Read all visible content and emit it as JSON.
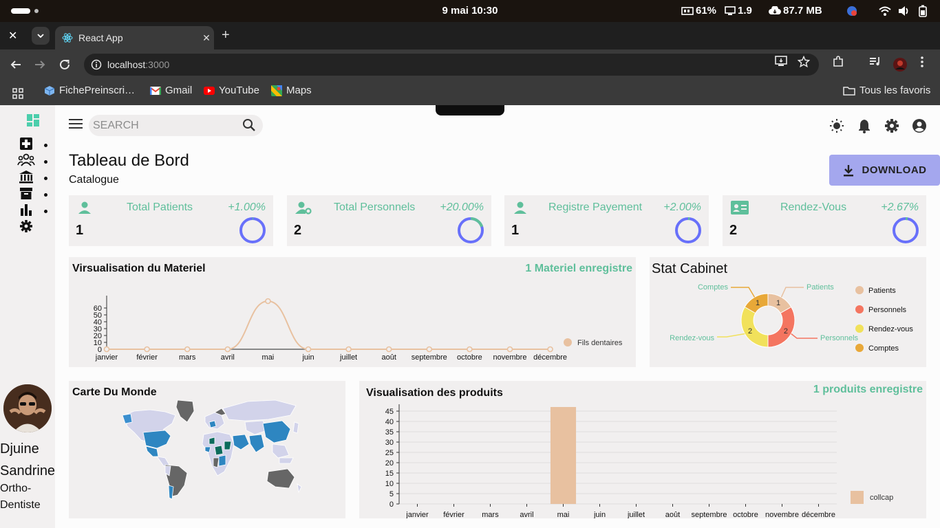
{
  "status_bar": {
    "date_time": "9 mai  10:30",
    "battery_saver": "61%",
    "screen_value": "1.9",
    "data_usage": "87.7 MB"
  },
  "browser": {
    "tab_title": "React App",
    "url_host": "localhost",
    "url_port": ":3000",
    "bookmarks": [
      "FichePreinscri…",
      "Gmail",
      "YouTube",
      "Maps"
    ],
    "all_bookmarks": "Tous les favoris"
  },
  "topbar": {
    "search_placeholder": "SEARCH"
  },
  "header": {
    "title": "Tableau de Bord",
    "subtitle": "Catalogue",
    "download_label": "DOWNLOAD"
  },
  "stats": [
    {
      "title": "Total Patients",
      "value": "1",
      "change": "+1.00%",
      "progress": 0.01
    },
    {
      "title": "Total Personnels",
      "value": "2",
      "change": "+20.00%",
      "progress": 0.2
    },
    {
      "title": "Registre Payement",
      "value": "1",
      "change": "+2.00%",
      "progress": 0.02
    },
    {
      "title": "Rendez-Vous",
      "value": "2",
      "change": "+2.67%",
      "progress": 0.0267
    }
  ],
  "materiel": {
    "title": "Virsualisation du Materiel",
    "count_label": "1 Materiel enregistre"
  },
  "cabinet": {
    "title": "Stat Cabinet"
  },
  "map": {
    "title": "Carte Du Monde"
  },
  "produits": {
    "title": "Visualisation des produits",
    "count_label": "1 produits enregistre"
  },
  "user": {
    "first_name": "Djuine",
    "last_name": "Sandrine",
    "role_line1": "Ortho-",
    "role_line2": "Dentiste"
  },
  "chart_data": [
    {
      "type": "line",
      "categories": [
        "janvier",
        "février",
        "mars",
        "avril",
        "mai",
        "juin",
        "juillet",
        "août",
        "septembre",
        "octobre",
        "novembre",
        "décembre"
      ],
      "series": [
        {
          "name": "Fils dentaires",
          "values": [
            0,
            0,
            0,
            0,
            70,
            0,
            0,
            0,
            0,
            0,
            0,
            0
          ],
          "color": "#e8c1a0"
        }
      ],
      "yticks": [
        0,
        10,
        20,
        30,
        40,
        50,
        60
      ],
      "ylim": [
        0,
        70
      ]
    },
    {
      "type": "pie",
      "labels": [
        "Patients",
        "Personnels",
        "Rendez-vous",
        "Comptes"
      ],
      "values": [
        1,
        2,
        2,
        1
      ],
      "colors": [
        "#e8c1a0",
        "#f47560",
        "#f1e15b",
        "#e8a838"
      ]
    },
    {
      "type": "bar",
      "categories": [
        "janvier",
        "février",
        "mars",
        "avril",
        "mai",
        "juin",
        "juillet",
        "août",
        "septembre",
        "octobre",
        "novembre",
        "décembre"
      ],
      "series": [
        {
          "name": "collcap",
          "values": [
            0,
            0,
            0,
            0,
            47,
            0,
            0,
            0,
            0,
            0,
            0,
            0
          ],
          "color": "#e8c1a0"
        }
      ],
      "yticks": [
        0,
        5,
        10,
        15,
        20,
        25,
        30,
        35,
        40,
        45
      ],
      "ylim": [
        0,
        47
      ]
    }
  ],
  "colors": {
    "accent_green": "#5fbf9b",
    "ring_blue": "#6870fa",
    "download_bg": "#a4a7ee",
    "card_bg": "#f1efef"
  }
}
